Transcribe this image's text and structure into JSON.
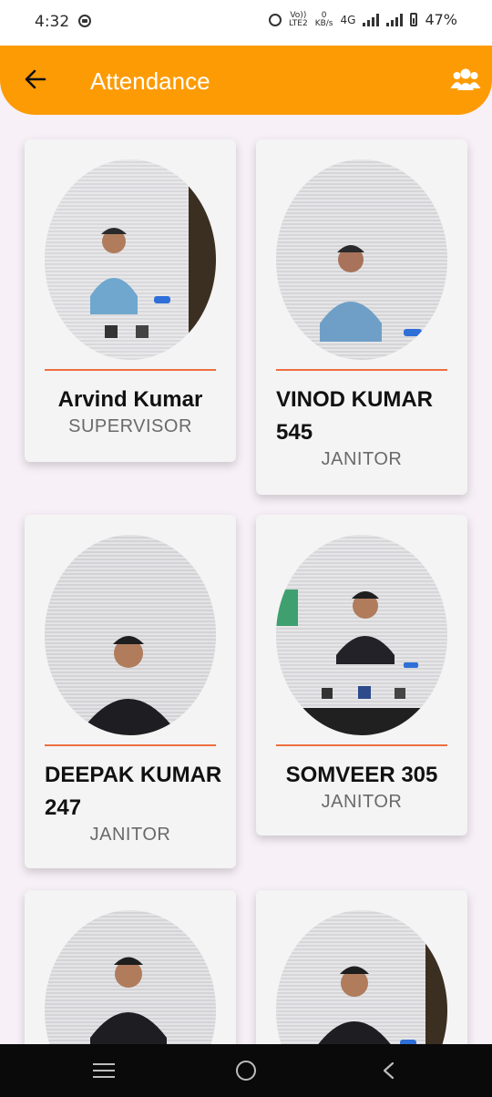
{
  "status_bar": {
    "time": "4:32",
    "network_top": "Vo))",
    "network_bottom": "LTE2",
    "speed_top": "0",
    "speed_bottom": "KB/s",
    "net_type": "4G",
    "battery": "47%"
  },
  "app_bar": {
    "title": "Attendance",
    "back_icon": "arrow-left-icon",
    "action_icon": "group-icon"
  },
  "colors": {
    "accent": "#fd9b05",
    "divider": "#ee6e3f",
    "background": "#f7f0f7"
  },
  "employees": [
    {
      "name": "Arvind Kumar",
      "role": "SUPERVISOR"
    },
    {
      "name": "VINOD KUMAR 545",
      "role": "JANITOR"
    },
    {
      "name": "DEEPAK KUMAR 247",
      "role": "JANITOR"
    },
    {
      "name": "SOMVEER 305",
      "role": "JANITOR"
    },
    {
      "name": "",
      "role": ""
    },
    {
      "name": "",
      "role": ""
    }
  ],
  "nav_bar": {
    "recent_icon": "recent-apps-icon",
    "home_icon": "home-icon",
    "back_icon": "back-icon"
  }
}
